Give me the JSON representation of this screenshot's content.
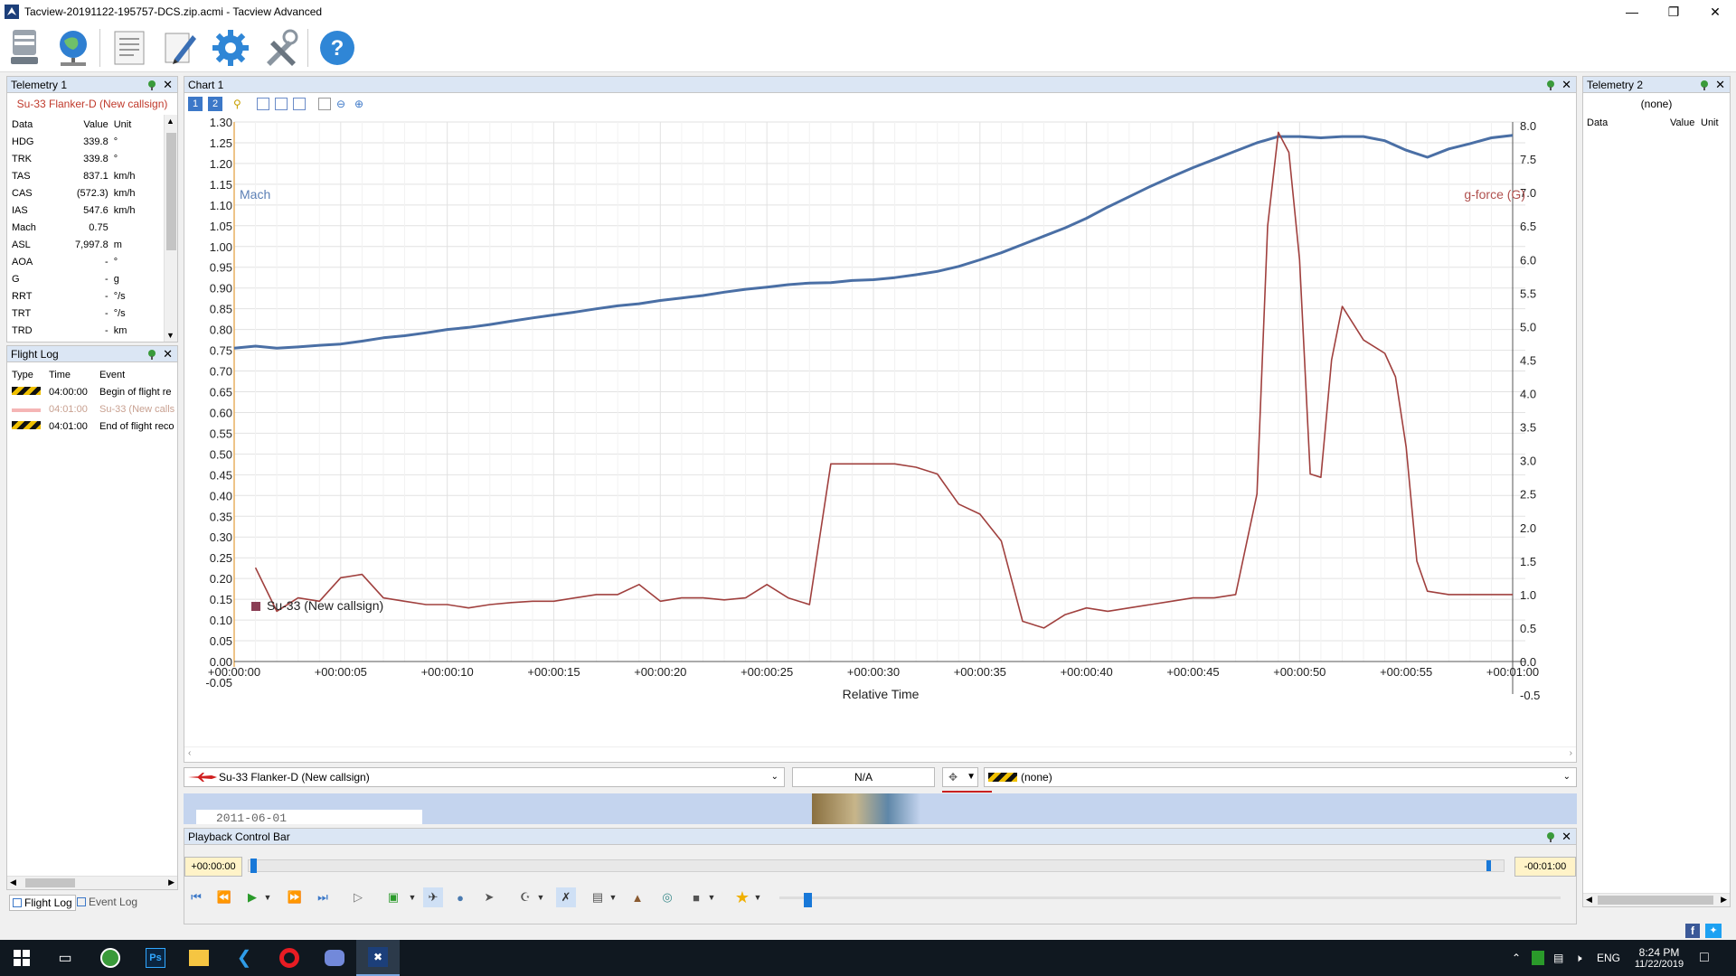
{
  "window": {
    "title": "Tacview-20191122-195757-DCS.zip.acmi - Tacview Advanced"
  },
  "toolbar": {
    "icons": [
      "hard-drive-icon",
      "globe-network-icon",
      "document-icon",
      "edit-pen-icon",
      "gear-icon",
      "tools-icon",
      "help-icon"
    ]
  },
  "telemetry1": {
    "title": "Telemetry 1",
    "object": "Su-33 Flanker-D (New callsign)",
    "headers": [
      "Data",
      "Value",
      "Unit"
    ],
    "rows": [
      {
        "data": "HDG",
        "value": "339.8",
        "unit": "°"
      },
      {
        "data": "TRK",
        "value": "339.8",
        "unit": "°"
      },
      {
        "data": "TAS",
        "value": "837.1",
        "unit": "km/h"
      },
      {
        "data": "CAS",
        "value": "(572.3)",
        "unit": "km/h"
      },
      {
        "data": "IAS",
        "value": "547.6",
        "unit": "km/h"
      },
      {
        "data": "Mach",
        "value": "0.75",
        "unit": ""
      },
      {
        "data": "ASL",
        "value": "7,997.8",
        "unit": "m"
      },
      {
        "data": "AOA",
        "value": "-",
        "unit": "°"
      },
      {
        "data": "G",
        "value": "-",
        "unit": "g"
      },
      {
        "data": "RRT",
        "value": "-",
        "unit": "°/s"
      },
      {
        "data": "TRT",
        "value": "-",
        "unit": "°/s"
      },
      {
        "data": "TRD",
        "value": "-",
        "unit": "km"
      }
    ]
  },
  "flightlog": {
    "title": "Flight Log",
    "headers": [
      "Type",
      "Time",
      "Event"
    ],
    "rows": [
      {
        "type": "flag",
        "time": "04:00:00",
        "event": "Begin of flight re"
      },
      {
        "type": "aircraft",
        "time": "04:01:00",
        "event": "Su-33 (New calls"
      },
      {
        "type": "flag",
        "time": "04:01:00",
        "event": "End of flight reco"
      }
    ],
    "tabs": [
      "Flight Log",
      "Event Log"
    ]
  },
  "telemetry2": {
    "title": "Telemetry 2",
    "object": "(none)",
    "headers": [
      "Data",
      "Value",
      "Unit"
    ]
  },
  "chart_panel": {
    "title": "Chart 1",
    "object_select": "Su-33 Flanker-D (New callsign)",
    "na": "N/A",
    "right_select": "(none)"
  },
  "map_strip": {
    "date": "2011-06-01"
  },
  "playback": {
    "title": "Playback Control Bar",
    "start": "+00:00:00",
    "end": "-00:01:00"
  },
  "taskbar": {
    "lang": "ENG",
    "time": "8:24 PM",
    "date": "11/22/2019"
  },
  "chart_data": {
    "type": "line",
    "xlabel": "Relative Time",
    "x_ticks": [
      "+00:00:00",
      "+00:00:05",
      "+00:00:10",
      "+00:00:15",
      "+00:00:20",
      "+00:00:25",
      "+00:00:30",
      "+00:00:35",
      "+00:00:40",
      "+00:00:45",
      "+00:00:50",
      "+00:00:55",
      "+00:01:00"
    ],
    "xlim": [
      0,
      60
    ],
    "y_left": {
      "label": "Mach",
      "ylim": [
        0,
        1.3
      ],
      "ticks": [
        "1.30",
        "1.25",
        "1.20",
        "1.15",
        "1.10",
        "1.05",
        "1.00",
        "0.95",
        "0.90",
        "0.85",
        "0.80",
        "0.75",
        "0.70",
        "0.65",
        "0.60",
        "0.55",
        "0.50",
        "0.45",
        "0.40",
        "0.35",
        "0.30",
        "0.25",
        "0.20",
        "0.15",
        "0.10",
        "0.05",
        "0.00",
        "-0.05"
      ]
    },
    "y_right": {
      "label": "g-force (G)",
      "ylim": [
        0,
        8
      ],
      "ticks": [
        "8.0",
        "7.5",
        "7.0",
        "6.5",
        "6.0",
        "5.5",
        "5.0",
        "4.5",
        "4.0",
        "3.5",
        "3.0",
        "2.5",
        "2.0",
        "1.5",
        "1.0",
        "0.5",
        "0.0",
        "-0.5"
      ]
    },
    "grid": true,
    "legend": "Su-33 (New callsign)",
    "series": [
      {
        "axis": "left",
        "color": "#4a6fa5",
        "x": [
          0,
          1,
          2,
          3,
          4,
          5,
          6,
          7,
          8,
          9,
          10,
          11,
          12,
          13,
          14,
          15,
          16,
          17,
          18,
          19,
          20,
          21,
          22,
          23,
          24,
          25,
          26,
          27,
          28,
          29,
          30,
          31,
          32,
          33,
          34,
          35,
          36,
          37,
          38,
          39,
          40,
          41,
          42,
          43,
          44,
          45,
          46,
          47,
          48,
          49,
          50,
          51,
          52,
          53,
          54,
          55,
          56,
          57,
          58,
          59,
          60
        ],
        "y": [
          0.755,
          0.76,
          0.755,
          0.758,
          0.762,
          0.765,
          0.772,
          0.78,
          0.785,
          0.792,
          0.8,
          0.805,
          0.812,
          0.82,
          0.828,
          0.835,
          0.842,
          0.85,
          0.857,
          0.862,
          0.87,
          0.876,
          0.882,
          0.89,
          0.897,
          0.902,
          0.908,
          0.912,
          0.913,
          0.918,
          0.92,
          0.925,
          0.932,
          0.94,
          0.952,
          0.968,
          0.985,
          1.005,
          1.025,
          1.045,
          1.068,
          1.095,
          1.12,
          1.145,
          1.168,
          1.19,
          1.21,
          1.23,
          1.25,
          1.265,
          1.265,
          1.262,
          1.265,
          1.265,
          1.255,
          1.232,
          1.215,
          1.235,
          1.248,
          1.262,
          1.268
        ]
      },
      {
        "axis": "right",
        "color": "#a0403e",
        "x": [
          1,
          2,
          3,
          4,
          5,
          6,
          7,
          8,
          9,
          10,
          11,
          12,
          13,
          14,
          15,
          16,
          17,
          18,
          19,
          20,
          21,
          22,
          23,
          24,
          25,
          26,
          27,
          28,
          29,
          30,
          31,
          32,
          33,
          34,
          35,
          36,
          37,
          38,
          39,
          40,
          41,
          42,
          43,
          44,
          45,
          46,
          47,
          48,
          48.5,
          49,
          49.5,
          50,
          50.5,
          51,
          51.5,
          52,
          53,
          54,
          54.5,
          55,
          55.5,
          56,
          57,
          58,
          59,
          60
        ],
        "y": [
          1.4,
          0.75,
          0.95,
          0.9,
          1.25,
          1.3,
          0.95,
          0.9,
          0.85,
          0.85,
          0.8,
          0.85,
          0.88,
          0.9,
          0.9,
          0.95,
          1.0,
          1.0,
          1.15,
          0.9,
          0.95,
          0.95,
          0.92,
          0.95,
          1.15,
          0.95,
          0.85,
          2.95,
          2.95,
          2.95,
          2.95,
          2.9,
          2.8,
          2.35,
          2.2,
          1.8,
          0.6,
          0.5,
          0.7,
          0.8,
          0.75,
          0.8,
          0.85,
          0.9,
          0.95,
          0.95,
          1.0,
          2.5,
          6.5,
          7.9,
          7.6,
          6.0,
          2.8,
          2.75,
          4.5,
          5.3,
          4.8,
          4.6,
          4.25,
          3.2,
          1.5,
          1.05,
          1.0,
          1.0,
          1.0,
          1.0
        ]
      }
    ]
  }
}
